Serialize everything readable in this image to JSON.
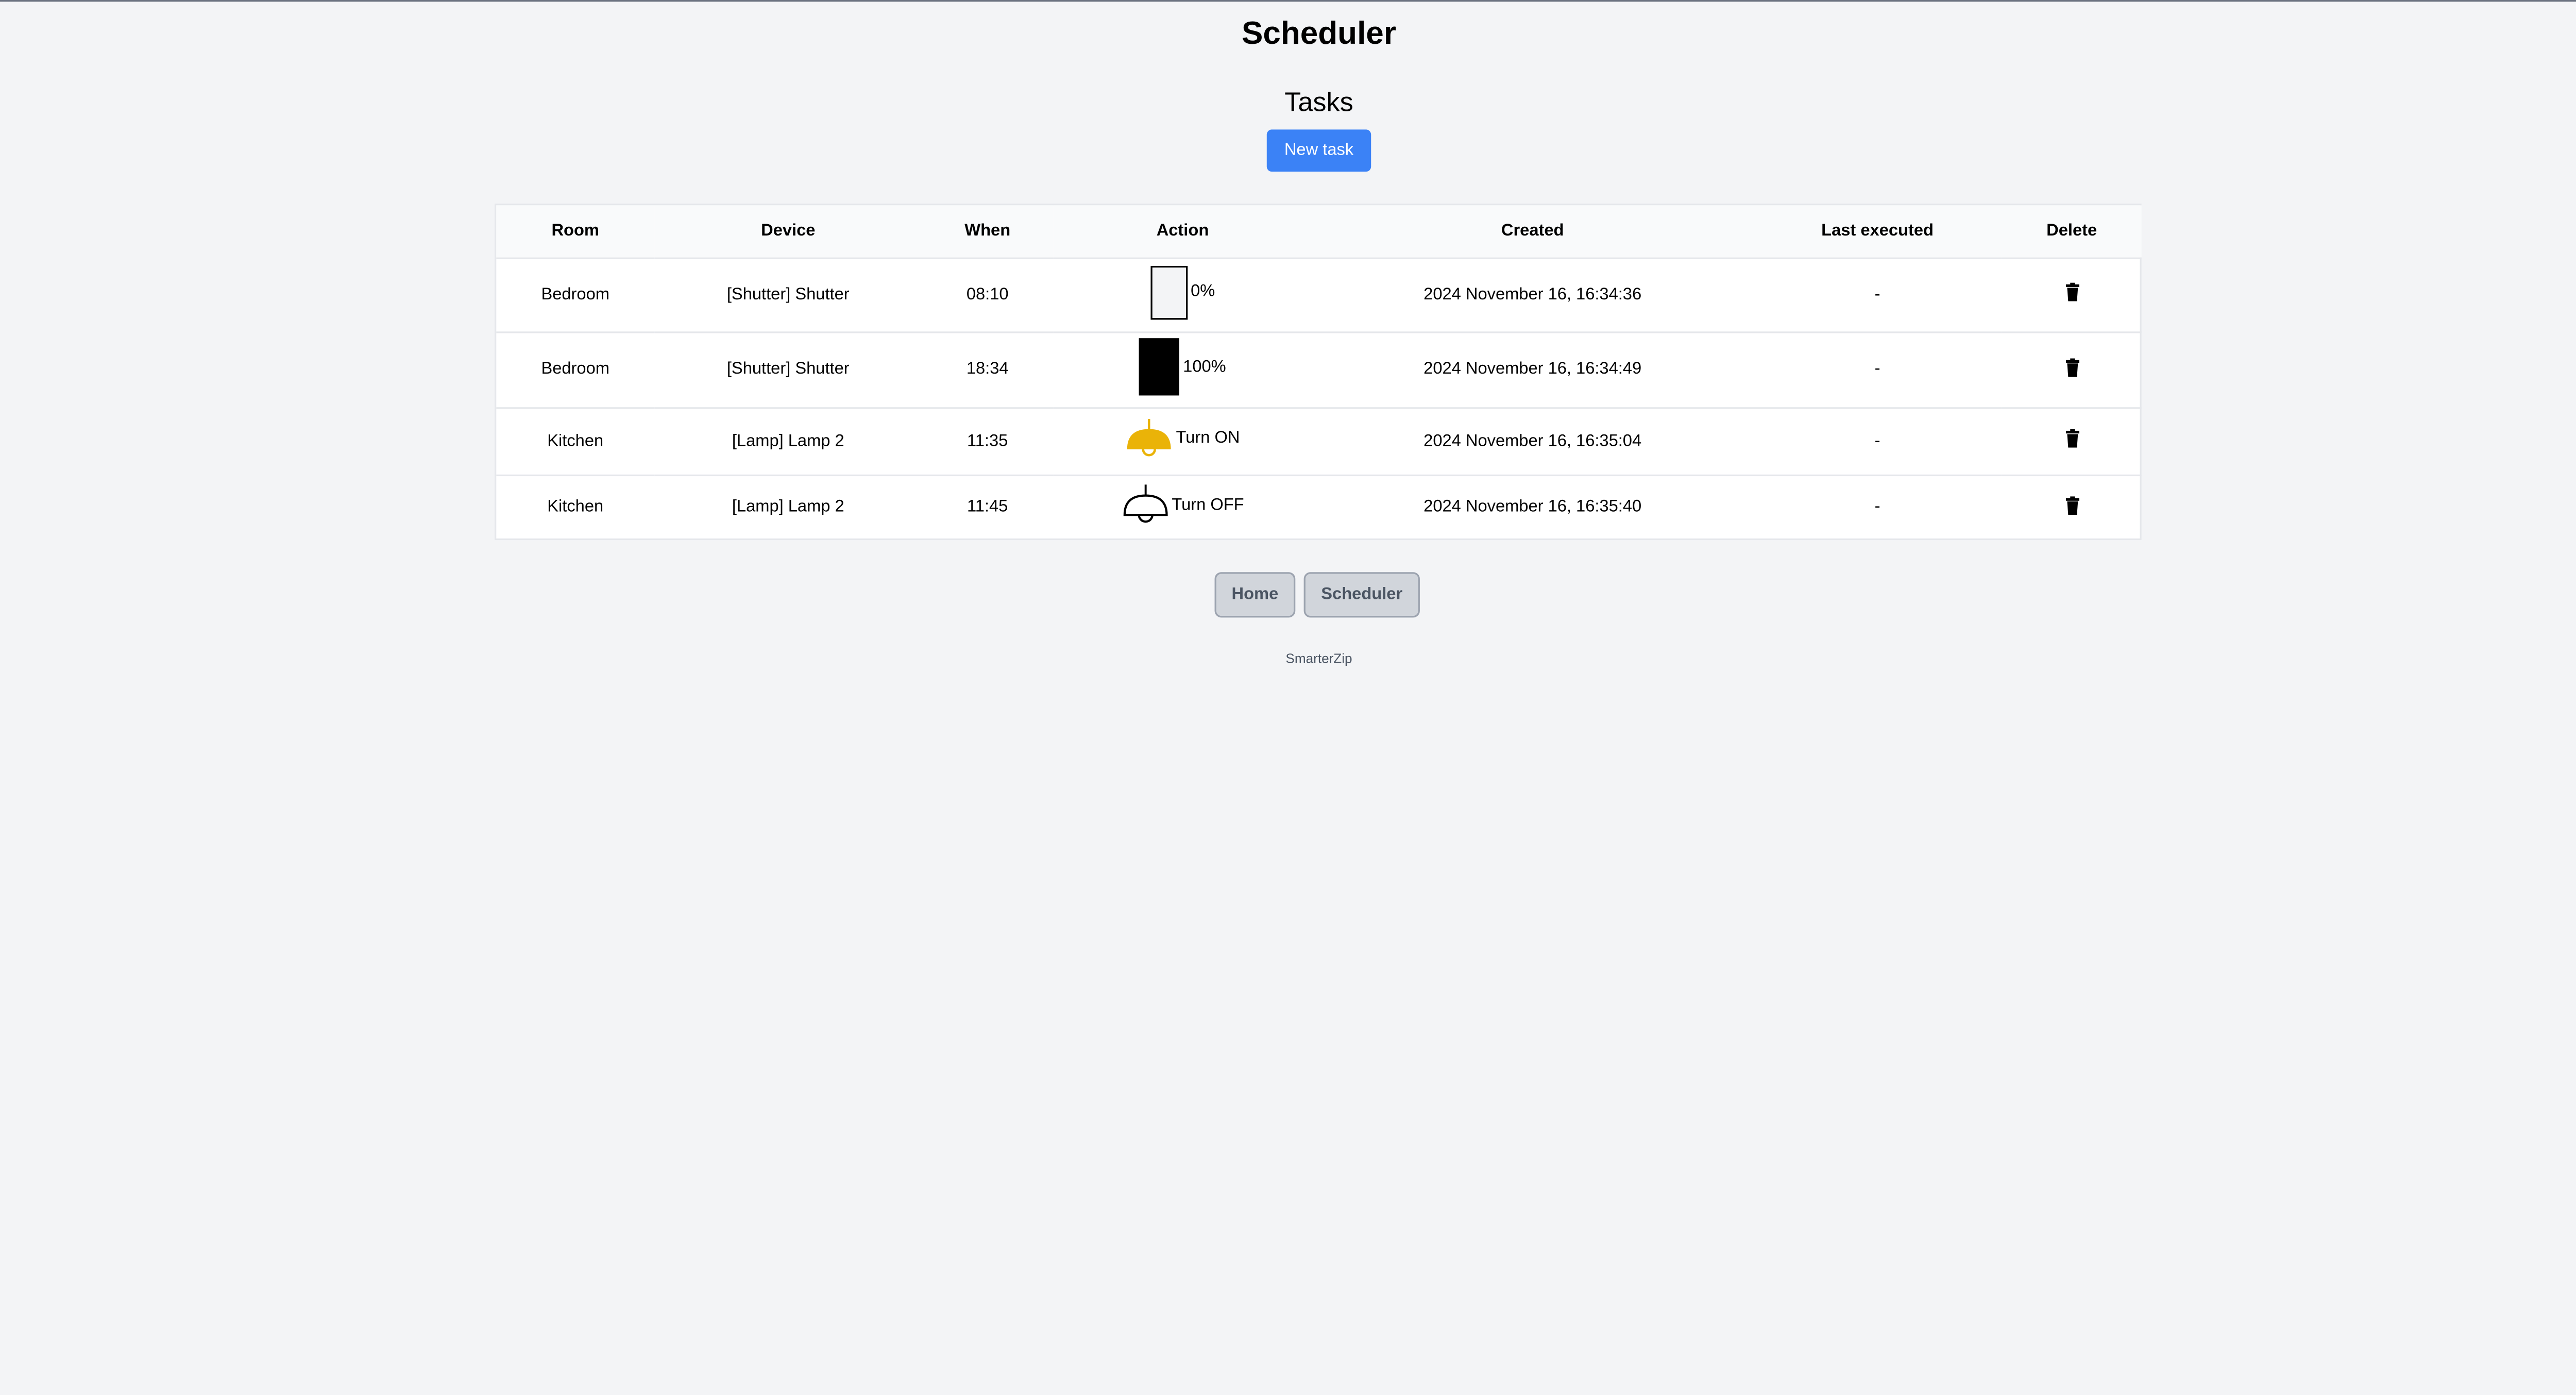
{
  "header": {
    "title": "Scheduler"
  },
  "tasks_section": {
    "title": "Tasks",
    "new_task_label": "New task"
  },
  "table": {
    "columns": [
      "Room",
      "Device",
      "When",
      "Action",
      "Created",
      "Last executed",
      "Delete"
    ],
    "rows": [
      {
        "room": "Bedroom",
        "device": "[Shutter] Shutter",
        "when": "08:10",
        "action_icon": "shutter-open-icon",
        "action": "0%",
        "created": "2024 November 16, 16:34:36",
        "last_executed": "-"
      },
      {
        "room": "Bedroom",
        "device": "[Shutter] Shutter",
        "when": "18:34",
        "action_icon": "shutter-closed-icon",
        "action": "100%",
        "created": "2024 November 16, 16:34:49",
        "last_executed": "-"
      },
      {
        "room": "Kitchen",
        "device": "[Lamp] Lamp 2",
        "when": "11:35",
        "action_icon": "lamp-on-icon",
        "action": "Turn ON",
        "created": "2024 November 16, 16:35:04",
        "last_executed": "-"
      },
      {
        "room": "Kitchen",
        "device": "[Lamp] Lamp 2",
        "when": "11:45",
        "action_icon": "lamp-off-icon",
        "action": "Turn OFF",
        "created": "2024 November 16, 16:35:40",
        "last_executed": "-"
      }
    ]
  },
  "nav": {
    "home_label": "Home",
    "scheduler_label": "Scheduler"
  },
  "footer": {
    "text": "SmarterZip"
  },
  "colors": {
    "primary": "#3b82f6",
    "lamp_on": "#eab308",
    "background": "#f3f4f6"
  }
}
